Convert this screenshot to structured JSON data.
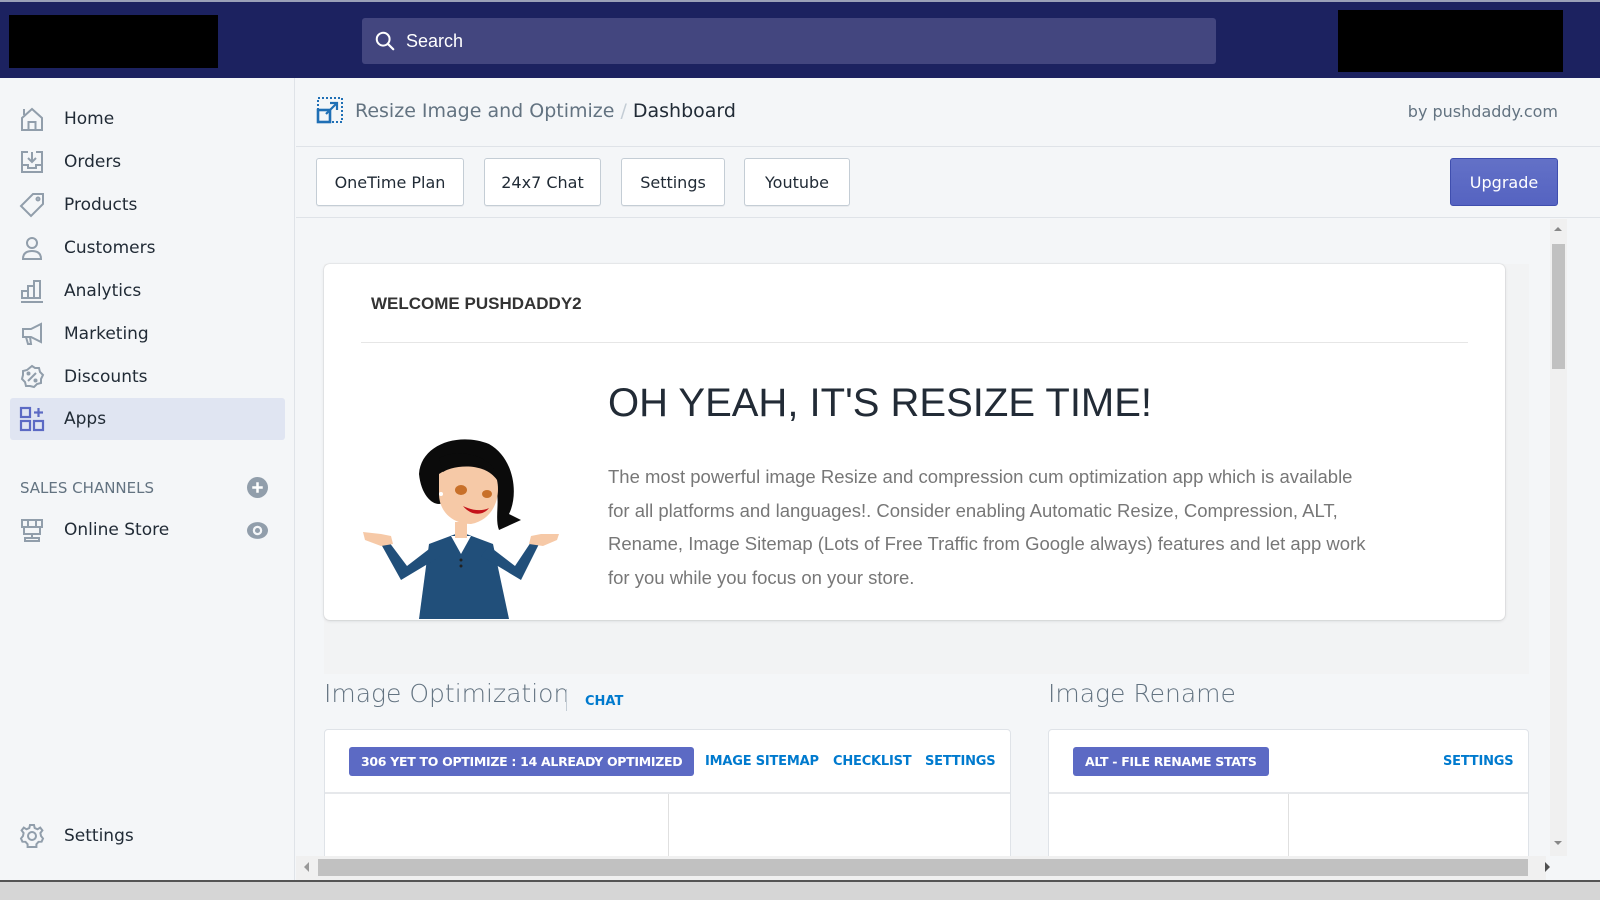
{
  "topbar": {
    "search_placeholder": "Search"
  },
  "sidebar": {
    "items": [
      {
        "label": "Home",
        "icon": "home-icon"
      },
      {
        "label": "Orders",
        "icon": "orders-icon"
      },
      {
        "label": "Products",
        "icon": "tag-icon"
      },
      {
        "label": "Customers",
        "icon": "person-icon"
      },
      {
        "label": "Analytics",
        "icon": "bar-chart-icon"
      },
      {
        "label": "Marketing",
        "icon": "megaphone-icon"
      },
      {
        "label": "Discounts",
        "icon": "discount-icon"
      },
      {
        "label": "Apps",
        "icon": "apps-icon",
        "active": true
      }
    ],
    "sales_channels_heading": "SALES CHANNELS",
    "online_store_label": "Online Store",
    "settings_label": "Settings"
  },
  "app_header": {
    "app_name": "Resize Image and Optimize",
    "separator": "/",
    "current_page": "Dashboard",
    "by_line": "by pushdaddy.com"
  },
  "toolbar": {
    "buttons": [
      "OneTime Plan",
      "24x7 Chat",
      "Settings",
      "Youtube"
    ],
    "upgrade_label": "Upgrade"
  },
  "welcome": {
    "title": "WELCOME PUSHDADDY2",
    "headline": "OH YEAH, IT'S RESIZE TIME!",
    "description": "The most powerful image Resize and compression cum optimization app which is available for all platforms and languages!. Consider enabling Automatic Resize, Compression, ALT, Rename, Image Sitemap (Lots of Free Traffic from Google always) features and let app work for you while you focus on your store."
  },
  "image_optimization": {
    "title": "Image Optimization",
    "chat_link": "CHAT",
    "badge": "306 YET TO OPTIMIZE : 14 ALREADY OPTIMIZED",
    "yet_to_optimize": 306,
    "already_optimized": 14,
    "links": [
      "IMAGE SITEMAP",
      "CHECKLIST",
      "SETTINGS"
    ]
  },
  "image_rename": {
    "title": "Image Rename",
    "badge": "ALT - FILE RENAME STATS",
    "settings_link": "SETTINGS"
  },
  "colors": {
    "topbar": "#1c2260",
    "accent": "#5c6ac4",
    "link": "#007ace"
  }
}
